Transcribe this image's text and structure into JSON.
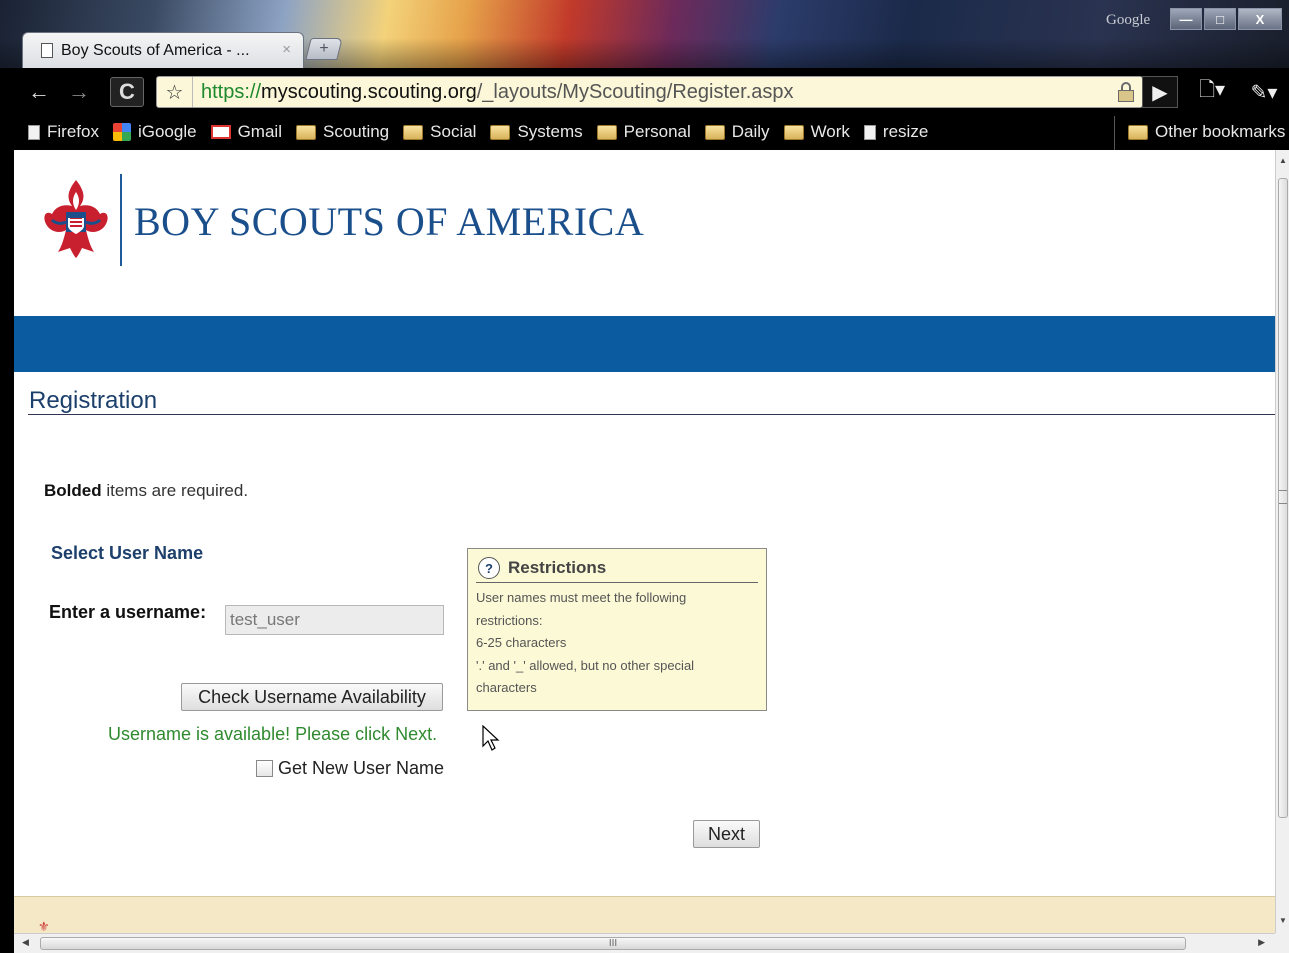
{
  "browser": {
    "corner_label": "Google",
    "window_buttons": {
      "minimize": "—",
      "maximize": "□",
      "close": "X"
    },
    "tab": {
      "title": "Boy Scouts of America - ...",
      "close_glyph": "×",
      "new_tab_glyph": "+"
    },
    "nav": {
      "back": "←",
      "forward": "→",
      "reload": "C"
    },
    "address": {
      "scheme": "https://",
      "host": "myscouting.scouting.org",
      "path": "/_layouts/MyScouting/Register.aspx",
      "star_glyph": "☆"
    },
    "toolbar_right": {
      "play": "▶",
      "page_menu": "🗋▾",
      "wrench_menu": "✎▾"
    },
    "bookmarks": [
      {
        "label": "Firefox",
        "icon": "page-icon"
      },
      {
        "label": "iGoogle",
        "icon": "igoogle-icon"
      },
      {
        "label": "Gmail",
        "icon": "gmail-icon"
      },
      {
        "label": "Scouting",
        "icon": "folder-icon"
      },
      {
        "label": "Social",
        "icon": "folder-icon"
      },
      {
        "label": "Systems",
        "icon": "folder-icon"
      },
      {
        "label": "Personal",
        "icon": "folder-icon"
      },
      {
        "label": "Daily",
        "icon": "folder-icon"
      },
      {
        "label": "Work",
        "icon": "folder-icon"
      },
      {
        "label": "resize",
        "icon": "page-icon"
      }
    ],
    "other_bookmarks": "Other bookmarks",
    "hscroll_grip": "III"
  },
  "page": {
    "brand": "BOY SCOUTS OF AMERICA",
    "brand_colors": {
      "primary": "#1a4f8c",
      "band": "#0b5ba0",
      "accent_red": "#c8202f"
    },
    "heading": "Registration",
    "required_note": {
      "bold": "Bolded",
      "rest": " items are required."
    },
    "section_title": "Select User Name",
    "username": {
      "label": "Enter a username:",
      "value": "test_user"
    },
    "check_button": "Check Username Availability",
    "status_message": "Username is available! Please click Next.",
    "status_color": "#2f8a2f",
    "new_name_checkbox": {
      "label": "Get New User Name",
      "checked": false
    },
    "restrictions": {
      "title": "Restrictions",
      "icon": "help-icon",
      "lines": [
        "User names must meet the following",
        "restrictions:",
        "6-25 characters",
        "'.' and '_' allowed, but no other special",
        "characters"
      ]
    },
    "next_button": "Next"
  }
}
